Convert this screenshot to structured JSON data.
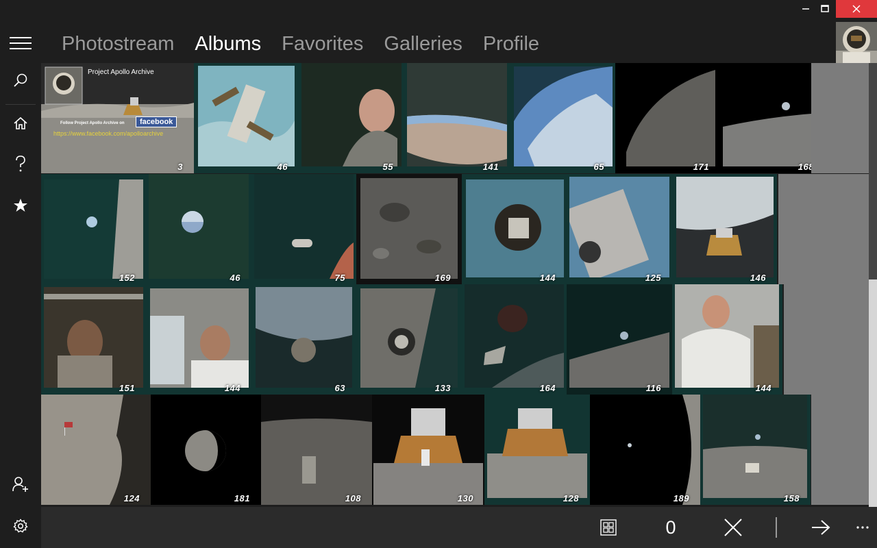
{
  "window": {
    "min_icon": "minimize-icon",
    "max_icon": "maximize-icon",
    "close_icon": "close-icon"
  },
  "nav": {
    "tabs": [
      "Photostream",
      "Albums",
      "Favorites",
      "Galleries",
      "Profile"
    ],
    "active": "Albums"
  },
  "sidebar": {
    "items": [
      "menu-icon",
      "search-icon",
      "home-icon",
      "help-icon",
      "star-icon",
      "add-user-icon",
      "settings-icon"
    ]
  },
  "banner": {
    "title": "Project Apollo Archive",
    "follow": "Follow Project Apollo Archive on",
    "facebook": "facebook",
    "url": "https://www.facebook.com/apolloarchive"
  },
  "albums": {
    "rows": [
      [
        "3",
        "46",
        "55",
        "141",
        "65",
        "171",
        "168"
      ],
      [
        "152",
        "46",
        "75",
        "169",
        "144",
        "125",
        "146"
      ],
      [
        "151",
        "144",
        "63",
        "133",
        "164",
        "116",
        "144"
      ],
      [
        "124",
        "181",
        "108",
        "130",
        "128",
        "189",
        "158"
      ]
    ]
  },
  "bottombar": {
    "selected_count": "0",
    "icons": [
      "select-all-icon",
      "cancel-icon",
      "forward-icon",
      "more-icon"
    ]
  },
  "colors": {
    "close_button": "#e0383c",
    "accent_bg": "#123532"
  }
}
